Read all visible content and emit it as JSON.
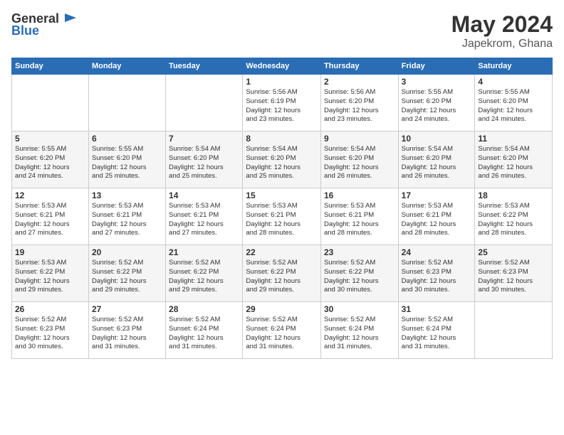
{
  "header": {
    "logo_general": "General",
    "logo_blue": "Blue",
    "month_title": "May 2024",
    "location": "Japekrom, Ghana"
  },
  "weekdays": [
    "Sunday",
    "Monday",
    "Tuesday",
    "Wednesday",
    "Thursday",
    "Friday",
    "Saturday"
  ],
  "weeks": [
    [
      {
        "day": "",
        "info": ""
      },
      {
        "day": "",
        "info": ""
      },
      {
        "day": "",
        "info": ""
      },
      {
        "day": "1",
        "info": "Sunrise: 5:56 AM\nSunset: 6:19 PM\nDaylight: 12 hours\nand 23 minutes."
      },
      {
        "day": "2",
        "info": "Sunrise: 5:56 AM\nSunset: 6:20 PM\nDaylight: 12 hours\nand 23 minutes."
      },
      {
        "day": "3",
        "info": "Sunrise: 5:55 AM\nSunset: 6:20 PM\nDaylight: 12 hours\nand 24 minutes."
      },
      {
        "day": "4",
        "info": "Sunrise: 5:55 AM\nSunset: 6:20 PM\nDaylight: 12 hours\nand 24 minutes."
      }
    ],
    [
      {
        "day": "5",
        "info": "Sunrise: 5:55 AM\nSunset: 6:20 PM\nDaylight: 12 hours\nand 24 minutes."
      },
      {
        "day": "6",
        "info": "Sunrise: 5:55 AM\nSunset: 6:20 PM\nDaylight: 12 hours\nand 25 minutes."
      },
      {
        "day": "7",
        "info": "Sunrise: 5:54 AM\nSunset: 6:20 PM\nDaylight: 12 hours\nand 25 minutes."
      },
      {
        "day": "8",
        "info": "Sunrise: 5:54 AM\nSunset: 6:20 PM\nDaylight: 12 hours\nand 25 minutes."
      },
      {
        "day": "9",
        "info": "Sunrise: 5:54 AM\nSunset: 6:20 PM\nDaylight: 12 hours\nand 26 minutes."
      },
      {
        "day": "10",
        "info": "Sunrise: 5:54 AM\nSunset: 6:20 PM\nDaylight: 12 hours\nand 26 minutes."
      },
      {
        "day": "11",
        "info": "Sunrise: 5:54 AM\nSunset: 6:20 PM\nDaylight: 12 hours\nand 26 minutes."
      }
    ],
    [
      {
        "day": "12",
        "info": "Sunrise: 5:53 AM\nSunset: 6:21 PM\nDaylight: 12 hours\nand 27 minutes."
      },
      {
        "day": "13",
        "info": "Sunrise: 5:53 AM\nSunset: 6:21 PM\nDaylight: 12 hours\nand 27 minutes."
      },
      {
        "day": "14",
        "info": "Sunrise: 5:53 AM\nSunset: 6:21 PM\nDaylight: 12 hours\nand 27 minutes."
      },
      {
        "day": "15",
        "info": "Sunrise: 5:53 AM\nSunset: 6:21 PM\nDaylight: 12 hours\nand 28 minutes."
      },
      {
        "day": "16",
        "info": "Sunrise: 5:53 AM\nSunset: 6:21 PM\nDaylight: 12 hours\nand 28 minutes."
      },
      {
        "day": "17",
        "info": "Sunrise: 5:53 AM\nSunset: 6:21 PM\nDaylight: 12 hours\nand 28 minutes."
      },
      {
        "day": "18",
        "info": "Sunrise: 5:53 AM\nSunset: 6:22 PM\nDaylight: 12 hours\nand 28 minutes."
      }
    ],
    [
      {
        "day": "19",
        "info": "Sunrise: 5:53 AM\nSunset: 6:22 PM\nDaylight: 12 hours\nand 29 minutes."
      },
      {
        "day": "20",
        "info": "Sunrise: 5:52 AM\nSunset: 6:22 PM\nDaylight: 12 hours\nand 29 minutes."
      },
      {
        "day": "21",
        "info": "Sunrise: 5:52 AM\nSunset: 6:22 PM\nDaylight: 12 hours\nand 29 minutes."
      },
      {
        "day": "22",
        "info": "Sunrise: 5:52 AM\nSunset: 6:22 PM\nDaylight: 12 hours\nand 29 minutes."
      },
      {
        "day": "23",
        "info": "Sunrise: 5:52 AM\nSunset: 6:22 PM\nDaylight: 12 hours\nand 30 minutes."
      },
      {
        "day": "24",
        "info": "Sunrise: 5:52 AM\nSunset: 6:23 PM\nDaylight: 12 hours\nand 30 minutes."
      },
      {
        "day": "25",
        "info": "Sunrise: 5:52 AM\nSunset: 6:23 PM\nDaylight: 12 hours\nand 30 minutes."
      }
    ],
    [
      {
        "day": "26",
        "info": "Sunrise: 5:52 AM\nSunset: 6:23 PM\nDaylight: 12 hours\nand 30 minutes."
      },
      {
        "day": "27",
        "info": "Sunrise: 5:52 AM\nSunset: 6:23 PM\nDaylight: 12 hours\nand 31 minutes."
      },
      {
        "day": "28",
        "info": "Sunrise: 5:52 AM\nSunset: 6:24 PM\nDaylight: 12 hours\nand 31 minutes."
      },
      {
        "day": "29",
        "info": "Sunrise: 5:52 AM\nSunset: 6:24 PM\nDaylight: 12 hours\nand 31 minutes."
      },
      {
        "day": "30",
        "info": "Sunrise: 5:52 AM\nSunset: 6:24 PM\nDaylight: 12 hours\nand 31 minutes."
      },
      {
        "day": "31",
        "info": "Sunrise: 5:52 AM\nSunset: 6:24 PM\nDaylight: 12 hours\nand 31 minutes."
      },
      {
        "day": "",
        "info": ""
      }
    ]
  ]
}
